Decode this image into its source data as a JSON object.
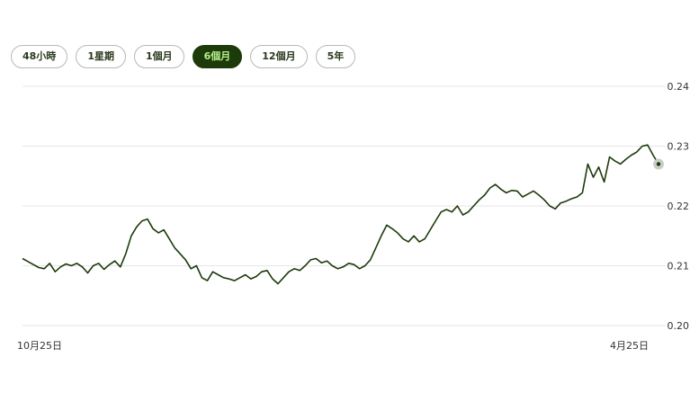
{
  "range_tabs": [
    {
      "label": "48小時",
      "active": false
    },
    {
      "label": "1星期",
      "active": false
    },
    {
      "label": "1個月",
      "active": false
    },
    {
      "label": "6個月",
      "active": true
    },
    {
      "label": "12個月",
      "active": false
    },
    {
      "label": "5年",
      "active": false
    }
  ],
  "colors": {
    "line": "#1c3a0a",
    "grid": "#e6e6e6",
    "active_tab_bg": "#1c3a0a",
    "active_tab_text": "#b7f08a",
    "marker": "#c9cec6"
  },
  "chart_data": {
    "type": "line",
    "title": "",
    "xlabel": "",
    "ylabel": "",
    "ylim": [
      0.2,
      0.24
    ],
    "y_ticks": [
      "0.24",
      "0.23",
      "0.22",
      "0.21",
      "0.20"
    ],
    "x_ticks": [
      "10月25日",
      "4月25日"
    ],
    "grid": true,
    "y_axis_side": "right",
    "series": [
      {
        "values": [
          0.2112,
          0.2107,
          0.2102,
          0.2097,
          0.2095,
          0.2104,
          0.209,
          0.2098,
          0.2103,
          0.21,
          0.2104,
          0.2098,
          0.2088,
          0.21,
          0.2104,
          0.2094,
          0.2102,
          0.2108,
          0.2098,
          0.212,
          0.215,
          0.2165,
          0.2175,
          0.2178,
          0.2162,
          0.2155,
          0.216,
          0.2145,
          0.213,
          0.212,
          0.211,
          0.2095,
          0.21,
          0.208,
          0.2075,
          0.209,
          0.2085,
          0.208,
          0.2078,
          0.2075,
          0.208,
          0.2085,
          0.2078,
          0.2082,
          0.209,
          0.2092,
          0.2078,
          0.207,
          0.208,
          0.209,
          0.2095,
          0.2092,
          0.21,
          0.211,
          0.2112,
          0.2105,
          0.2108,
          0.21,
          0.2095,
          0.2098,
          0.2104,
          0.2102,
          0.2095,
          0.21,
          0.211,
          0.213,
          0.215,
          0.2168,
          0.2162,
          0.2155,
          0.2145,
          0.214,
          0.215,
          0.214,
          0.2145,
          0.216,
          0.2175,
          0.219,
          0.2194,
          0.219,
          0.22,
          0.2185,
          0.219,
          0.22,
          0.221,
          0.2218,
          0.223,
          0.2236,
          0.2228,
          0.2222,
          0.2226,
          0.2225,
          0.2215,
          0.222,
          0.2225,
          0.2218,
          0.221,
          0.22,
          0.2195,
          0.2205,
          0.2208,
          0.2212,
          0.2215,
          0.2222,
          0.227,
          0.2248,
          0.2265,
          0.224,
          0.2282,
          0.2275,
          0.227,
          0.2278,
          0.2285,
          0.229,
          0.23,
          0.2302,
          0.2285,
          0.227
        ]
      }
    ]
  }
}
